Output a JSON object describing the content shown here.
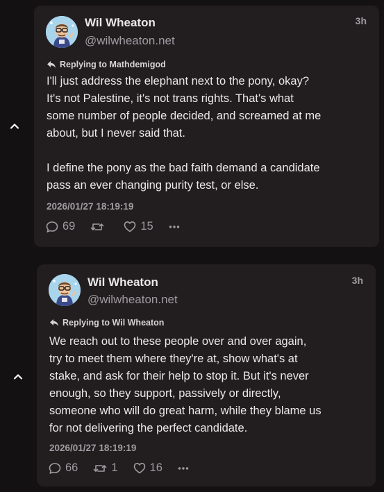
{
  "icons": {
    "collapse": "chevron-up-icon",
    "reply_to": "reply-arrow-icon",
    "reply": "comment-bubble-icon",
    "repost": "repost-icon",
    "like": "heart-icon",
    "more": "ellipsis-icon"
  },
  "colors": {
    "background": "#141112",
    "card": "#221e20",
    "text": "#ece8ea",
    "muted": "#a29aa0"
  },
  "posts": [
    {
      "author_name": "Wil Wheaton",
      "author_handle": "@wilwheaton.net",
      "time_ago": "3h",
      "reply_label": "Replying to Mathdemigod",
      "body_lines": [
        "I'll just address the elephant next to the pony, okay?",
        "It's not Palestine, it's not trans rights. That's what",
        "some number of people decided, and screamed at me",
        "about, but I never said that.",
        "I define the pony as the bad faith demand a candidate",
        "pass an ever changing purity test, or else."
      ],
      "timestamp": "2026/01/27 18:19:19",
      "reply_count": "69",
      "repost_count": "",
      "like_count": "15"
    },
    {
      "author_name": "Wil Wheaton",
      "author_handle": "@wilwheaton.net",
      "time_ago": "3h",
      "reply_label": "Replying to Wil Wheaton",
      "body_lines": [
        "We reach out to these people over and over again,",
        "try to meet them where they're at, show what's at",
        "stake, and ask for their help to stop it. But it's never",
        "enough, so they support, passively or directly,",
        "someone who will do great harm, while they blame us",
        "for not delivering the perfect candidate."
      ],
      "timestamp": "2026/01/27 18:19:19",
      "reply_count": "66",
      "repost_count": "1",
      "like_count": "16"
    }
  ]
}
